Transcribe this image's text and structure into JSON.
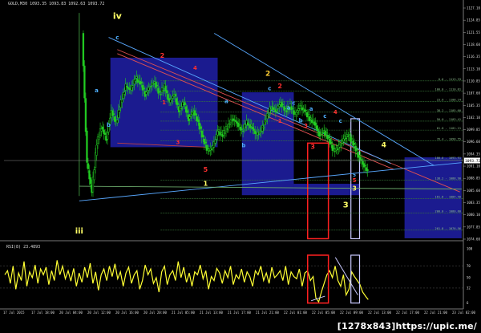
{
  "chart_data": [
    {
      "type": "candlestick",
      "header": "GOLD,M30  1093.35 1093.83 1092.63 1093.72",
      "ylim": [
        1074.0,
        1132.0
      ],
      "y_ticks": [
        "1127.10",
        "1124.85",
        "1121.55",
        "1118.60",
        "1116.35",
        "1113.10",
        "1110.85",
        "1107.60",
        "1105.35",
        "1102.10",
        "1099.85",
        "1096.60",
        "1094.35",
        "1091.10",
        "1088.85",
        "1085.60",
        "1083.35",
        "1080.10",
        "1077.85",
        "1074.60"
      ],
      "current_price": "1093.72",
      "x_ticks": [
        "17 Jul 2015",
        "17 Jul 18:00",
        "20 Jul 04:00",
        "20 Jul 12:00",
        "20 Jul 16:00",
        "20 Jul 20:00",
        "21 Jul 05:00",
        "21 Jul 13:00",
        "21 Jul 17:00",
        "21 Jul 21:00",
        "22 Jul 01:00",
        "22 Jul 05:00",
        "22 Jul 09:00",
        "22 Jul 13:00",
        "22 Jul 17:00",
        "22 Jul 21:00",
        "23 Jul 02:00"
      ],
      "price_path": [
        [
          0,
          1125
        ],
        [
          1,
          1093
        ],
        [
          2,
          1086
        ],
        [
          3,
          1098
        ],
        [
          4,
          1102
        ],
        [
          5,
          1099
        ],
        [
          6,
          1106
        ],
        [
          7,
          1103
        ],
        [
          8,
          1108
        ],
        [
          9,
          1112
        ],
        [
          10,
          1111
        ],
        [
          11,
          1114
        ],
        [
          12,
          1113
        ],
        [
          13,
          1110
        ],
        [
          14,
          1112
        ],
        [
          15,
          1113
        ],
        [
          16,
          1110
        ],
        [
          17,
          1112
        ],
        [
          18,
          1108
        ],
        [
          19,
          1110
        ],
        [
          20,
          1106
        ],
        [
          21,
          1108
        ],
        [
          22,
          1104
        ],
        [
          23,
          1106
        ],
        [
          24,
          1103
        ],
        [
          25,
          1099
        ],
        [
          26,
          1096
        ],
        [
          27,
          1097
        ],
        [
          28,
          1101
        ],
        [
          29,
          1100
        ],
        [
          30,
          1102
        ],
        [
          31,
          1104
        ],
        [
          32,
          1103
        ],
        [
          33,
          1101
        ],
        [
          34,
          1103
        ],
        [
          35,
          1102
        ],
        [
          36,
          1100
        ],
        [
          37,
          1101
        ],
        [
          38,
          1104
        ],
        [
          39,
          1107
        ],
        [
          40,
          1106
        ],
        [
          41,
          1108
        ],
        [
          42,
          1106
        ],
        [
          43,
          1107
        ],
        [
          44,
          1105
        ],
        [
          45,
          1107
        ],
        [
          46,
          1106
        ],
        [
          47,
          1104
        ],
        [
          48,
          1103
        ],
        [
          49,
          1100
        ],
        [
          50,
          1101
        ],
        [
          51,
          1099
        ],
        [
          52,
          1096
        ],
        [
          53,
          1097
        ],
        [
          54,
          1099
        ],
        [
          55,
          1100
        ],
        [
          56,
          1098
        ],
        [
          57,
          1095
        ],
        [
          58,
          1093
        ],
        [
          59,
          1091
        ]
      ],
      "fib_levels": [
        {
          "label": "0.0 - 1113.33",
          "price": 1113.3
        },
        {
          "label": "100.0 - 1110.81",
          "price": 1110.8
        },
        {
          "label": "23.6 - 1108.24",
          "price": 1108.2
        },
        {
          "label": "38.2 - 1105.60",
          "price": 1105.6
        },
        {
          "label": "50.0 - 1103.41",
          "price": 1103.4
        },
        {
          "label": "61.8 - 1101.21",
          "price": 1101.2
        },
        {
          "label": "76.4 - 1098.55",
          "price": 1098.6
        },
        {
          "label": "100.0 - 1093.91",
          "price": 1093.9
        },
        {
          "label": "138.2 - 1088.90",
          "price": 1088.9
        },
        {
          "label": "161.8 - 1084.40",
          "price": 1084.4
        },
        {
          "label": "200.0 - 1080.80",
          "price": 1080.8
        },
        {
          "label": "261.8 - 1076.56",
          "price": 1076.6
        }
      ],
      "wave_labels": [
        {
          "text": "iv",
          "color": "#ffff66",
          "time": 2.0,
          "price": 1128.5,
          "size": 11
        },
        {
          "text": "iii",
          "color": "#ffff66",
          "time": -0.2,
          "price": 1075.8,
          "size": 10
        },
        {
          "text": "c",
          "color": "#4fb0ff",
          "time": 2.0,
          "price": 1123.5,
          "size": 7
        },
        {
          "text": "a",
          "color": "#4fb0ff",
          "time": 0.8,
          "price": 1110.5,
          "size": 7
        },
        {
          "text": "b",
          "color": "#4fb0ff",
          "time": 1.5,
          "price": 1102.0,
          "size": 7
        },
        {
          "text": "2",
          "color": "#ff3030",
          "time": 4.6,
          "price": 1119.0,
          "size": 8
        },
        {
          "text": "4",
          "color": "#ff3030",
          "time": 6.5,
          "price": 1116.0,
          "size": 7
        },
        {
          "text": "1",
          "color": "#ff3030",
          "time": 4.7,
          "price": 1107.5,
          "size": 7
        },
        {
          "text": "3",
          "color": "#ff3030",
          "time": 5.5,
          "price": 1097.8,
          "size": 7
        },
        {
          "text": "5",
          "color": "#ff3030",
          "time": 7.1,
          "price": 1091.0,
          "size": 8
        },
        {
          "text": "1",
          "color": "#ffff66",
          "time": 7.1,
          "price": 1087.5,
          "size": 8
        },
        {
          "text": "a",
          "color": "#4fb0ff",
          "time": 8.3,
          "price": 1107.8,
          "size": 7
        },
        {
          "text": "b",
          "color": "#4fb0ff",
          "time": 9.3,
          "price": 1097.0,
          "size": 7
        },
        {
          "text": "2",
          "color": "#ffcc33",
          "time": 10.7,
          "price": 1114.5,
          "size": 9
        },
        {
          "text": "c",
          "color": "#4fb0ff",
          "time": 10.8,
          "price": 1111.0,
          "size": 7
        },
        {
          "text": "2",
          "color": "#ff3030",
          "time": 11.4,
          "price": 1111.5,
          "size": 8
        },
        {
          "text": "a",
          "color": "#4fb0ff",
          "time": 11.9,
          "price": 1106.3,
          "size": 7
        },
        {
          "text": "c",
          "color": "#4fb0ff",
          "time": 12.2,
          "price": 1107.4,
          "size": 7
        },
        {
          "text": "b",
          "color": "#4fb0ff",
          "time": 12.6,
          "price": 1103.1,
          "size": 7
        },
        {
          "text": "1",
          "color": "#ff3030",
          "time": 11.4,
          "price": 1103.0,
          "size": 7
        },
        {
          "text": "3",
          "color": "#ff3030",
          "time": 12.9,
          "price": 1101.8,
          "size": 7
        },
        {
          "text": "a",
          "color": "#4fb0ff",
          "time": 13.2,
          "price": 1106.0,
          "size": 7
        },
        {
          "text": "c",
          "color": "#4fb0ff",
          "time": 14.0,
          "price": 1104.2,
          "size": 7
        },
        {
          "text": "4",
          "color": "#ff3030",
          "time": 14.6,
          "price": 1105.2,
          "size": 7
        },
        {
          "text": "c",
          "color": "#4fb0ff",
          "time": 14.9,
          "price": 1103.0,
          "size": 7
        },
        {
          "text": "3",
          "color": "#ff3030",
          "time": 13.3,
          "price": 1096.6,
          "size": 8
        },
        {
          "text": "4",
          "color": "#ffff66",
          "time": 17.4,
          "price": 1097.0,
          "size": 9
        },
        {
          "text": "3",
          "color": "#ffff66",
          "time": 15.7,
          "price": 1086.3,
          "size": 8
        },
        {
          "text": "5",
          "color": "#ff3030",
          "time": 15.7,
          "price": 1088.4,
          "size": 7
        },
        {
          "text": "3",
          "color": "#ffff66",
          "time": 15.2,
          "price": 1082.2,
          "size": 10
        },
        {
          "text": "5",
          "color": "#4fb0ff",
          "time": 15.7,
          "price": 1089.8,
          "size": 6
        }
      ],
      "rsi": {
        "header": "RSI(8) 23.4893",
        "levels": [
          "100",
          "70",
          "50",
          "32",
          "6"
        ],
        "values": [
          55,
          62,
          40,
          70,
          30,
          58,
          45,
          78,
          35,
          60,
          50,
          72,
          40,
          65,
          55,
          68,
          38,
          62,
          45,
          80,
          55,
          70,
          48,
          62,
          44,
          66,
          35,
          58,
          42,
          68,
          50,
          75,
          40,
          60,
          28,
          55,
          65,
          45,
          70,
          52,
          74,
          48,
          60,
          35,
          58,
          68,
          40,
          55,
          62,
          30,
          45,
          72,
          55,
          65,
          40,
          50,
          25,
          60,
          70,
          38,
          55,
          62,
          45,
          78,
          50,
          68,
          42,
          58,
          35,
          60,
          55,
          72,
          48,
          62,
          30,
          52,
          45,
          66,
          58,
          40,
          62,
          50,
          70,
          38,
          55,
          48,
          65,
          42,
          60,
          52,
          35,
          62,
          55,
          70,
          45,
          58,
          40,
          68,
          50,
          55,
          62,
          45,
          70,
          38,
          60,
          52,
          48,
          65,
          35,
          58,
          62,
          45,
          52,
          15,
          8,
          25,
          40,
          55,
          62,
          50,
          70,
          45,
          35,
          55,
          20,
          30,
          60,
          52,
          45,
          38,
          25,
          18,
          12
        ]
      }
    }
  ],
  "watermark": "[1278x843]https://upic.me/"
}
